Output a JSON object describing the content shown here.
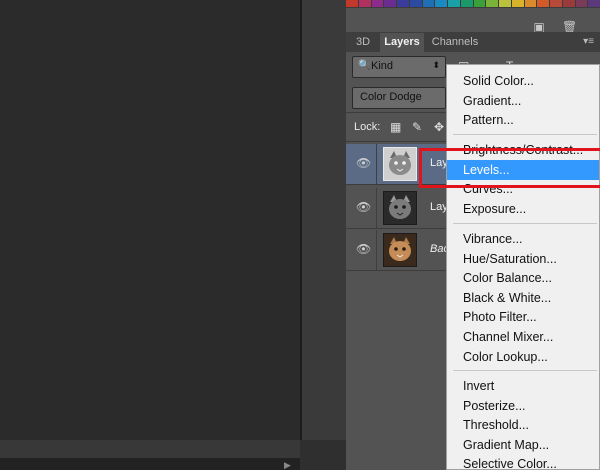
{
  "app": {
    "panel_tabs": [
      "3D",
      "Layers",
      "Channels"
    ],
    "panel_menu_icon": "panel-menu-icon"
  },
  "colors": {
    "panel_bg": "#535353",
    "menu_bg": "#f0f0f0",
    "menu_highlight": "#3399ff",
    "annotation_red": "#e1141b",
    "selected_layer": "#5b6b86"
  },
  "swatches": [
    "#c0392b",
    "#b03060",
    "#8e2a8c",
    "#6a2c8f",
    "#3b3b9c",
    "#2c4aa0",
    "#1f6fb5",
    "#1a8bc2",
    "#1aa0a6",
    "#1a9a6a",
    "#3aa03a",
    "#7bb23a",
    "#b9c23a",
    "#d8b22a",
    "#d98a2a",
    "#d25a2a",
    "#b84a3a",
    "#9a3a3a",
    "#7a3a5a",
    "#5a3a7a"
  ],
  "swatch_icons": [
    "new-swatch-icon",
    "trash-icon"
  ],
  "layers_panel": {
    "filter": {
      "label": "Kind",
      "icon": "search-icon"
    },
    "filter_icons": [
      "image-filter-icon",
      "adjustment-filter-icon",
      "type-filter-icon",
      "shape-filter-icon",
      "smart-object-filter-icon"
    ],
    "blend_mode": "Color Dodge",
    "lock_label": "Lock:",
    "lock_icons": [
      "lock-transparent-icon",
      "lock-brush-icon",
      "lock-position-icon"
    ],
    "layers": [
      {
        "name": "Lay",
        "selected": true,
        "italic": false,
        "thumb": "gray-cat-inverted"
      },
      {
        "name": "Lay",
        "selected": false,
        "italic": false,
        "thumb": "gray-cat"
      },
      {
        "name": "Bac",
        "selected": false,
        "italic": true,
        "thumb": "color-cat"
      }
    ]
  },
  "adjustment_menu": {
    "groups": [
      [
        "Solid Color...",
        "Gradient...",
        "Pattern..."
      ],
      [
        "Brightness/Contrast...",
        "Levels...",
        "Curves...",
        "Exposure..."
      ],
      [
        "Vibrance...",
        "Hue/Saturation...",
        "Color Balance...",
        "Black & White...",
        "Photo Filter...",
        "Channel Mixer...",
        "Color Lookup..."
      ],
      [
        "Invert",
        "Posterize...",
        "Threshold...",
        "Gradient Map...",
        "Selective Color..."
      ]
    ],
    "highlighted": "Levels..."
  }
}
